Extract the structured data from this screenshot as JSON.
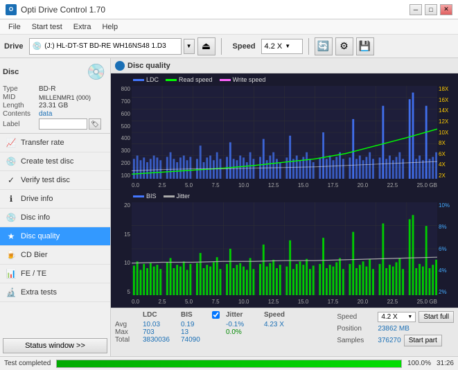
{
  "titlebar": {
    "icon": "O",
    "title": "Opti Drive Control 1.70",
    "min_btn": "─",
    "max_btn": "□",
    "close_btn": "✕"
  },
  "menubar": {
    "items": [
      "File",
      "Start test",
      "Extra",
      "Help"
    ]
  },
  "toolbar": {
    "drive_label": "Drive",
    "drive_value": "(J:)  HL-DT-ST BD-RE  WH16NS48 1.D3",
    "speed_label": "Speed",
    "speed_value": "4.2 X"
  },
  "disc": {
    "title": "Disc",
    "type_label": "Type",
    "type_value": "BD-R",
    "mid_label": "MID",
    "mid_value": "MILLENMR1 (000)",
    "length_label": "Length",
    "length_value": "23.31 GB",
    "contents_label": "Contents",
    "contents_value": "data",
    "label_label": "Label",
    "label_value": ""
  },
  "nav": {
    "items": [
      {
        "id": "transfer-rate",
        "label": "Transfer rate",
        "icon": "📈"
      },
      {
        "id": "create-test-disc",
        "label": "Create test disc",
        "icon": "💿"
      },
      {
        "id": "verify-test-disc",
        "label": "Verify test disc",
        "icon": "✓"
      },
      {
        "id": "drive-info",
        "label": "Drive info",
        "icon": "ℹ"
      },
      {
        "id": "disc-info",
        "label": "Disc info",
        "icon": "💿"
      },
      {
        "id": "disc-quality",
        "label": "Disc quality",
        "icon": "★",
        "active": true
      },
      {
        "id": "cd-bier",
        "label": "CD Bier",
        "icon": "🍺"
      },
      {
        "id": "fe-te",
        "label": "FE / TE",
        "icon": "📊"
      },
      {
        "id": "extra-tests",
        "label": "Extra tests",
        "icon": "🔬"
      }
    ],
    "status_btn": "Status window >>"
  },
  "content": {
    "title": "Disc quality",
    "chart1": {
      "legend": [
        {
          "name": "LDC",
          "color": "#4477ff"
        },
        {
          "name": "Read speed",
          "color": "#00ff00"
        },
        {
          "name": "Write speed",
          "color": "#ff66ff"
        }
      ],
      "y_left": [
        "800",
        "700",
        "600",
        "500",
        "400",
        "300",
        "200",
        "100"
      ],
      "y_right": [
        "18X",
        "16X",
        "14X",
        "12X",
        "10X",
        "8X",
        "6X",
        "4X",
        "2X"
      ],
      "x_labels": [
        "0.0",
        "2.5",
        "5.0",
        "7.5",
        "10.0",
        "12.5",
        "15.0",
        "17.5",
        "20.0",
        "22.5",
        "25.0 GB"
      ]
    },
    "chart2": {
      "legend": [
        {
          "name": "BIS",
          "color": "#4477ff"
        },
        {
          "name": "Jitter",
          "color": "#aaaaaa"
        }
      ],
      "y_left": [
        "20",
        "15",
        "10",
        "5"
      ],
      "y_right": [
        "10%",
        "8%",
        "6%",
        "4%",
        "2%"
      ],
      "x_labels": [
        "0.0",
        "2.5",
        "5.0",
        "7.5",
        "10.0",
        "12.5",
        "15.0",
        "17.5",
        "20.0",
        "22.5",
        "25.0 GB"
      ]
    }
  },
  "stats": {
    "headers": [
      "",
      "LDC",
      "BIS",
      "",
      "Jitter",
      "Speed"
    ],
    "avg_label": "Avg",
    "avg_ldc": "10.03",
    "avg_bis": "0.19",
    "avg_jitter": "-0.1%",
    "avg_speed": "4.23 X",
    "max_label": "Max",
    "max_ldc": "703",
    "max_bis": "13",
    "max_jitter": "0.0%",
    "max_speed_label": "Position",
    "max_speed_value": "23862 MB",
    "total_label": "Total",
    "total_ldc": "3830036",
    "total_bis": "74090",
    "samples_label": "Samples",
    "samples_value": "376270",
    "jitter_checked": true,
    "jitter_label": "Jitter",
    "speed_display": "4.2 X",
    "start_full_btn": "Start full",
    "start_part_btn": "Start part"
  },
  "statusbar": {
    "status_text": "Test completed",
    "progress": 100,
    "progress_text": "100.0%",
    "time_text": "31:26"
  }
}
